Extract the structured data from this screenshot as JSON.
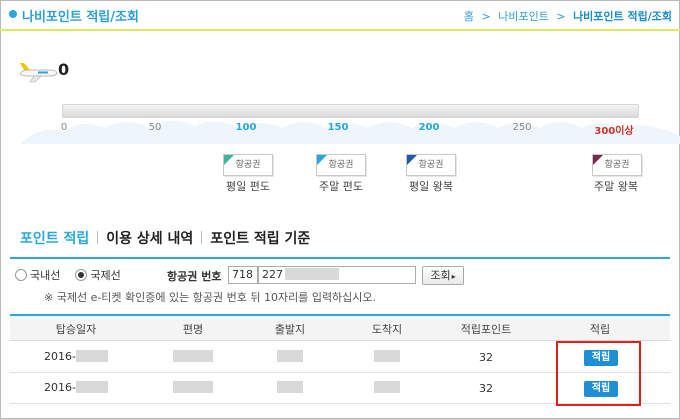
{
  "header": {
    "title": "나비포인트 적립/조회",
    "breadcrumb": [
      "홈",
      ">",
      "나비포인트",
      ">",
      "나비포인트 적립/조회"
    ]
  },
  "points": {
    "current": "0",
    "level": 0.0,
    "ticks": [
      "0",
      "50",
      "100",
      "150",
      "200",
      "250",
      "300이상"
    ]
  },
  "rewards": [
    {
      "badge": "항공권",
      "label": "평일 편도",
      "color": "#3bb7a0"
    },
    {
      "badge": "항공권",
      "label": "주말 편도",
      "color": "#2aa7de"
    },
    {
      "badge": "항공권",
      "label": "평일 왕복",
      "color": "#1e5ca8"
    },
    {
      "badge": "항공권",
      "label": "주말 왕복",
      "color": "#7a2a50"
    }
  ],
  "tabs": [
    "포인트 적립",
    "이용 상세 내역",
    "포인트 적립 기준"
  ],
  "form": {
    "radio_domestic": "국내선",
    "radio_international": "국제선",
    "ticket_label": "항공권 번호",
    "ticket_prefix": "718",
    "ticket_number": "227",
    "search_button": "조회",
    "notice": "※ 국제선 e-티켓 확인증에 있는 항공권 번호 뒤 10자리를 입력하십시오."
  },
  "table": {
    "headers": [
      "탑승일자",
      "편명",
      "출발지",
      "도착지",
      "적립포인트",
      "적립"
    ],
    "rows": [
      {
        "date": "2016-",
        "points": "32",
        "action": "적립"
      },
      {
        "date": "2016-",
        "points": "32",
        "action": "적립"
      }
    ]
  },
  "colors": {
    "accent": "#2aa7de",
    "highlight": "#e0201b",
    "button": "#1f8fd3"
  }
}
